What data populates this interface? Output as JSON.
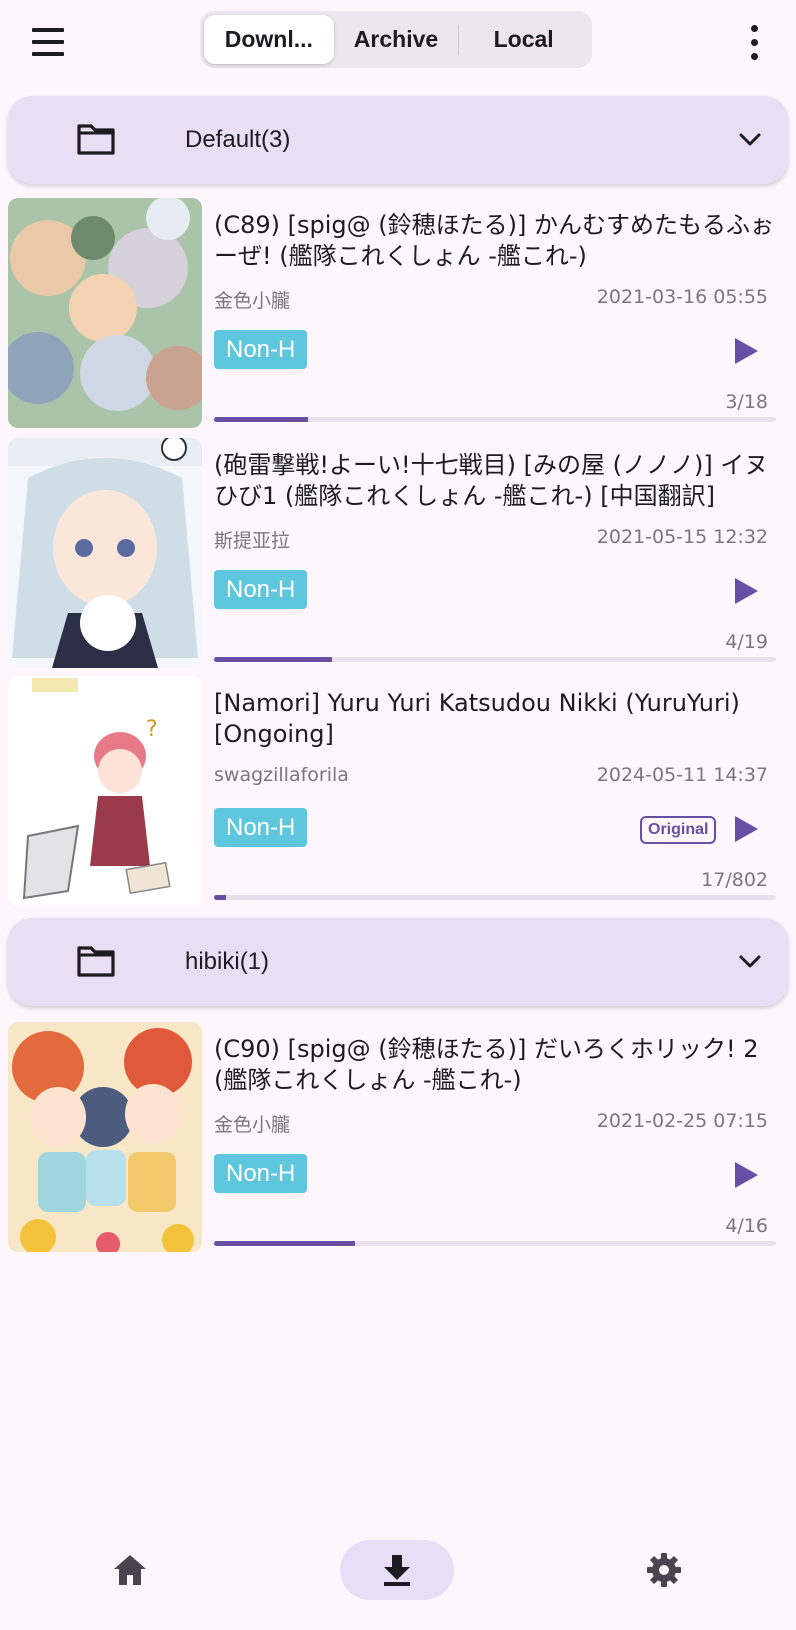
{
  "topbar": {
    "tabs": [
      {
        "label": "Downl...",
        "active": true
      },
      {
        "label": "Archive",
        "active": false
      },
      {
        "label": "Local",
        "active": false
      }
    ],
    "menu_icon": "hamburger-icon",
    "more_icon": "more-vert-icon"
  },
  "groups": [
    {
      "label": "Default(3)",
      "icon": "folder-icon"
    },
    {
      "label": "hibiki(1)",
      "icon": "folder-icon"
    }
  ],
  "items": [
    {
      "title": "(C89) [spig@ (鈴穂ほたる)] かんむすめたもるふぉーぜ! (艦隊これくしょん -艦これ-)",
      "uploader": "金色小朧",
      "date": "2021-03-16 05:55",
      "tag": "Non-H",
      "pages": "3/18",
      "progress": 0.167,
      "original": false
    },
    {
      "title": "(砲雷撃戦!よーい!十七戦目) [みの屋 (ノノノ)] イヌひび1 (艦隊これくしょん -艦これ-) [中国翻訳]",
      "uploader": "斯提亚拉",
      "date": "2021-05-15 12:32",
      "tag": "Non-H",
      "pages": "4/19",
      "progress": 0.21,
      "original": false
    },
    {
      "title": "[Namori] Yuru Yuri Katsudou Nikki (YuruYuri) [Ongoing]",
      "uploader": "swagzillaforila",
      "date": "2024-05-11 14:37",
      "tag": "Non-H",
      "pages": "17/802",
      "progress": 0.021,
      "original": true,
      "original_label": "Original"
    },
    {
      "title": "(C90) [spig@ (鈴穂ほたる)] だいろくホリック! 2 (艦隊これくしょん -艦これ-)",
      "uploader": "金色小朧",
      "date": "2021-02-25 07:15",
      "tag": "Non-H",
      "pages": "4/16",
      "progress": 0.25,
      "original": false
    }
  ],
  "bottomnav": {
    "items": [
      {
        "icon": "home-icon",
        "active": false
      },
      {
        "icon": "download-icon",
        "active": true
      },
      {
        "icon": "settings-icon",
        "active": false
      }
    ]
  },
  "colors": {
    "accent": "#6750a4",
    "tag": "#5ec7de",
    "group_bg": "#e8dff4",
    "background": "#fdf7fd"
  }
}
